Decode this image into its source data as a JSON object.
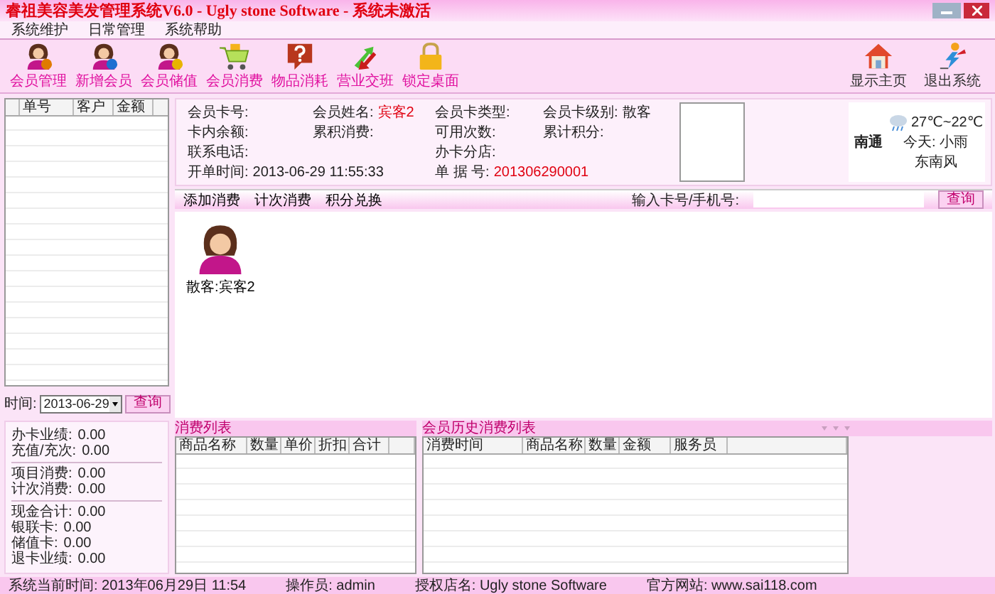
{
  "window": {
    "title": "睿祖美容美发管理系统V6.0 - Ugly stone Software - 系统未激活",
    "controls": [
      {
        "kind": "minimize"
      },
      {
        "kind": "close"
      }
    ]
  },
  "menu": [
    "系统维护",
    "日常管理",
    "系统帮助"
  ],
  "toolbar": [
    {
      "label": "会员管理",
      "kind": "member-edit"
    },
    {
      "label": "新增会员",
      "kind": "member-info"
    },
    {
      "label": "会员储值",
      "kind": "member-coin"
    },
    {
      "label": "会员消费",
      "kind": "cart"
    },
    {
      "label": "物品消耗",
      "kind": "question"
    },
    {
      "label": "营业交班",
      "kind": "swap"
    },
    {
      "label": "锁定桌面",
      "kind": "lock"
    }
  ],
  "toolbar_right": [
    {
      "label": "显示主页",
      "kind": "home"
    },
    {
      "label": "退出系统",
      "kind": "exit"
    }
  ],
  "order_list": {
    "columns": [
      "单号",
      "客户",
      "金额"
    ]
  },
  "query": {
    "label": "时间:",
    "date": "2013-06-29",
    "button": "查询"
  },
  "stat_groups": [
    [
      {
        "label": "办卡业绩:",
        "value": "0.00"
      },
      {
        "label": "充值/充次:",
        "value": "0.00"
      }
    ],
    [
      {
        "label": "项目消费:",
        "value": "0.00"
      },
      {
        "label": "计次消费:",
        "value": "0.00"
      }
    ],
    [
      {
        "label": "现金合计:",
        "value": "0.00"
      },
      {
        "label": "银联卡:",
        "value": "0.00"
      },
      {
        "label": "储值卡:",
        "value": "0.00"
      },
      {
        "label": "退卡业绩:",
        "value": "0.00"
      }
    ]
  ],
  "member": {
    "rows": [
      [
        {
          "label": "会员卡号:"
        },
        {
          "label": "会员姓名:",
          "value": "宾客2",
          "highlight": true
        },
        {
          "label": "会员卡类型:"
        },
        {
          "label": "会员卡级别:",
          "value": "散客",
          "highlight": false
        }
      ],
      [
        {
          "label": "卡内余额:"
        },
        {
          "label": "累积消费:"
        },
        {
          "label": "可用次数:"
        },
        {
          "label": "累计积分:"
        }
      ],
      [
        {
          "label": "联系电话:"
        },
        {
          "label": "办卡分店:"
        }
      ],
      [
        {
          "label": "开单时间:",
          "value": "2013-06-29 11:55:33",
          "highlight": false
        },
        {
          "label": "单 据 号:",
          "value": "201306290001",
          "highlight": true
        }
      ]
    ]
  },
  "weather": {
    "city": "南通",
    "temp": "27℃~22℃",
    "today": "今天: 小雨",
    "wind": "东南风"
  },
  "tabs": [
    "添加消费",
    "计次消费",
    "积分兑换"
  ],
  "search": {
    "label": "输入卡号/手机号:",
    "button": "查询"
  },
  "customers": [
    {
      "label": "散客:宾客2"
    }
  ],
  "sale_list": {
    "title": "消费列表",
    "columns": [
      "商品名称",
      "数量",
      "单价",
      "折扣",
      "合计"
    ]
  },
  "history": {
    "title": "会员历史消费列表",
    "columns": [
      "消费时间",
      "商品名称",
      "数量",
      "金额",
      "服务员"
    ]
  },
  "status_bar": [
    "系统当前时间: 2013年06月29日 11:54",
    "操作员: admin",
    "授权店名: Ugly stone Software",
    "官方网站: www.sai118.com"
  ]
}
